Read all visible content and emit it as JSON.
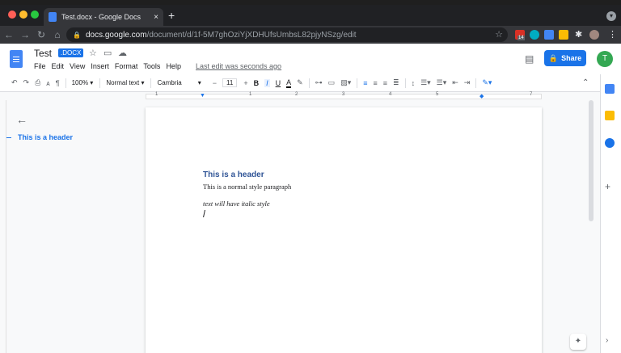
{
  "browser": {
    "tab_title": "Test.docx - Google Docs",
    "tab_close": "×",
    "new_tab": "+",
    "url_host": "docs.google.com",
    "url_path": "/document/d/1f-5M7ghOziYjXDHUfsUmbsL82pjyNSzg/edit",
    "extension_badge": "14"
  },
  "docs": {
    "title": "Test",
    "badge": ".DOCX",
    "menu": [
      "File",
      "Edit",
      "View",
      "Insert",
      "Format",
      "Tools",
      "Help"
    ],
    "last_edit": "Last edit was seconds ago",
    "share_label": "Share",
    "avatar_initial": "T"
  },
  "toolbar": {
    "zoom": "100%",
    "style": "Normal text",
    "font": "Cambria",
    "font_size": "11",
    "minus": "−",
    "plus": "+",
    "bold": "B",
    "italic": "I",
    "underline": "U",
    "text_color": "A"
  },
  "ruler": {
    "numbers": [
      "1",
      "1",
      "2",
      "3",
      "4",
      "5",
      "7"
    ]
  },
  "outline": {
    "items": [
      "This is a header"
    ]
  },
  "document": {
    "heading": "This is a header",
    "normal_paragraph": "This is a normal style paragraph",
    "italic_paragraph": "text will have italic style"
  },
  "colors": {
    "accent": "#1a73e8",
    "heading": "#2f5496"
  }
}
